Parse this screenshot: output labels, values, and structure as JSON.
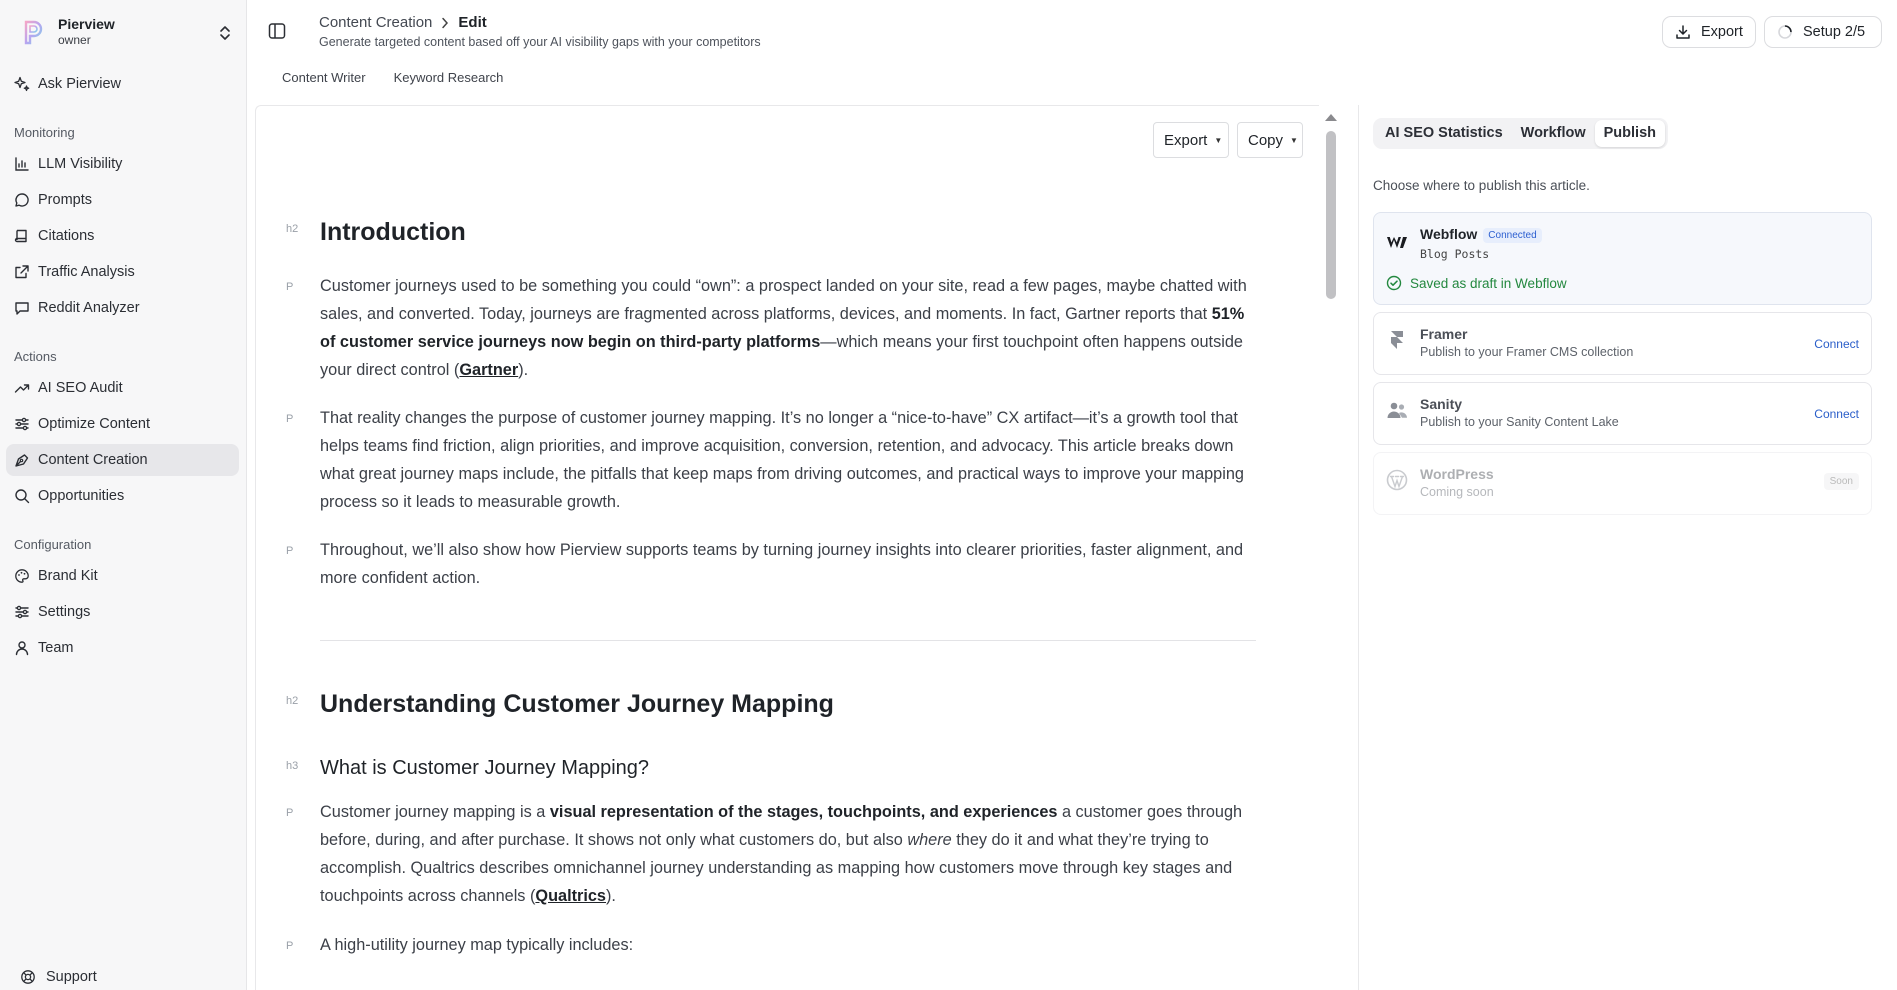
{
  "workspace": {
    "name": "Pierview",
    "role": "owner"
  },
  "nav": {
    "ask": "Ask Pierview",
    "sections": {
      "monitoring": "Monitoring",
      "actions": "Actions",
      "configuration": "Configuration"
    },
    "monitoring": [
      "LLM Visibility",
      "Prompts",
      "Citations",
      "Traffic Analysis",
      "Reddit Analyzer"
    ],
    "actions": [
      "AI SEO Audit",
      "Optimize Content",
      "Content Creation",
      "Opportunities"
    ],
    "configuration": [
      "Brand Kit",
      "Settings",
      "Team"
    ],
    "active": "Content Creation",
    "support": "Support"
  },
  "header": {
    "breadcrumb_parent": "Content Creation",
    "breadcrumb_current": "Edit",
    "subtitle": "Generate targeted content based off your AI visibility gaps with your competitors",
    "export_label": "Export",
    "setup_label": "Setup 2/5"
  },
  "subtabs": [
    "Content Writer",
    "Keyword Research"
  ],
  "editor": {
    "export_label": "Export",
    "copy_label": "Copy",
    "tags": {
      "h2": "h2",
      "h3": "h3",
      "p": "P"
    },
    "intro_heading": "Introduction",
    "p1_a": "Customer journeys used to be something you could “own”: a prospect landed on your site, read a few pages, maybe chatted with sales, and converted. Today, journeys are fragmented across platforms, devices, and moments. In fact, Gartner reports that ",
    "p1_bold": "51% of customer service journeys now begin on third-party platforms",
    "p1_b": "—which means your first touchpoint often happens outside your direct control (",
    "p1_link": "Gartner",
    "p1_c": ").",
    "p2": "That reality changes the purpose of customer journey mapping. It’s no longer a “nice-to-have” CX artifact—it’s a growth tool that helps teams find friction, align priorities, and improve acquisition, conversion, retention, and advocacy. This article breaks down what great journey maps include, the pitfalls that keep maps from driving outcomes, and practical ways to improve your mapping process so it leads to measurable growth.",
    "p3": "Throughout, we’ll also show how Pierview supports teams by turning journey insights into clearer priorities, faster alignment, and more confident action.",
    "section_heading": "Understanding Customer Journey Mapping",
    "sub_heading": "What is Customer Journey Mapping?",
    "p4_a": "Customer journey mapping is a ",
    "p4_bold": "visual representation of the stages, touchpoints, and experiences",
    "p4_b": " a customer goes through before, during, and after purchase. It shows not only what customers do, but also ",
    "p4_em": "where",
    "p4_c": " they do it and what they’re trying to accomplish. Qualtrics describes omnichannel journey understanding as mapping how customers move through key stages and touchpoints across channels (",
    "p4_link": "Qualtrics",
    "p4_d": ").",
    "p5": "A high-utility journey map typically includes:"
  },
  "panel": {
    "tabs": [
      "AI SEO Statistics",
      "Workflow",
      "Publish"
    ],
    "active_tab": "Publish",
    "description": "Choose where to publish this article.",
    "destinations": [
      {
        "name": "Webflow",
        "badge": "Connected",
        "detail": "Blog Posts",
        "status": "Saved as draft in Webflow"
      },
      {
        "name": "Framer",
        "detail": "Publish to your Framer CMS collection",
        "action": "Connect"
      },
      {
        "name": "Sanity",
        "detail": "Publish to your Sanity Content Lake",
        "action": "Connect"
      },
      {
        "name": "WordPress",
        "detail": "Coming soon",
        "badge": "Soon"
      }
    ]
  },
  "colors": {
    "accent": "#2a5ec9",
    "success": "#23883f",
    "sidebar_bg": "#f7f7f8",
    "active_nav": "#e7e7ea"
  }
}
